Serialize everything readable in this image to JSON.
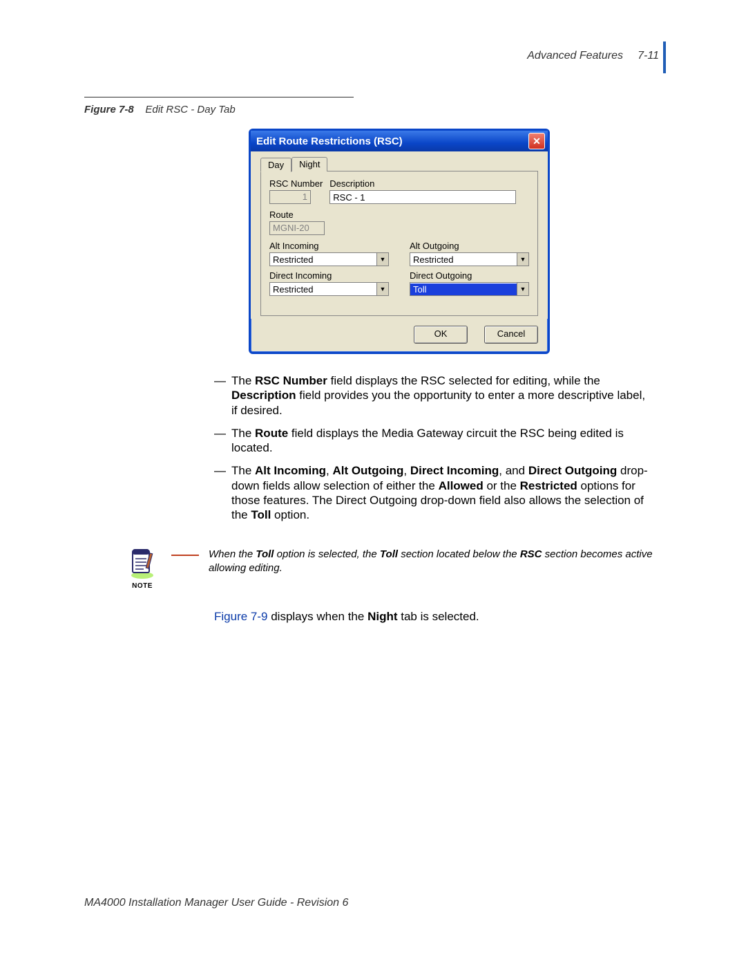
{
  "header": {
    "section": "Advanced Features",
    "pageNumber": "7-11"
  },
  "figure": {
    "label": "Figure 7-8",
    "title": "Edit RSC - Day Tab"
  },
  "dialog": {
    "title": "Edit Route Restrictions (RSC)",
    "closeGlyph": "✕",
    "tabs": {
      "day": "Day",
      "night": "Night"
    },
    "labels": {
      "rscNumber": "RSC Number",
      "description": "Description",
      "route": "Route",
      "altIncoming": "Alt Incoming",
      "altOutgoing": "Alt Outgoing",
      "directIncoming": "Direct Incoming",
      "directOutgoing": "Direct Outgoing"
    },
    "values": {
      "rscNumber": "1",
      "description": "RSC - 1",
      "route": "MGNI-20",
      "altIncoming": "Restricted",
      "altOutgoing": "Restricted",
      "directIncoming": "Restricted",
      "directOutgoing": "Toll"
    },
    "buttons": {
      "ok": "OK",
      "cancel": "Cancel"
    }
  },
  "bullets": {
    "b1_pre": "The ",
    "b1_bold1": "RSC Number",
    "b1_mid1": " field displays the RSC selected for editing, while the ",
    "b1_bold2": "Description",
    "b1_post": " field provides you the opportunity to enter a more descriptive label, if desired.",
    "b2_pre": "The ",
    "b2_bold1": "Route",
    "b2_post": " field displays the Media Gateway circuit the RSC being edited is located.",
    "b3_pre": "The ",
    "b3_bold1": "Alt Incoming",
    "b3_c1": ", ",
    "b3_bold2": "Alt Outgoing",
    "b3_c2": ", ",
    "b3_bold3": "Direct Incoming",
    "b3_c3": ", and ",
    "b3_bold4": "Direct Outgoing",
    "b3_mid": " drop-down fields allow selection of either the ",
    "b3_bold5": "Allowed",
    "b3_or": " or the ",
    "b3_bold6": "Restricted",
    "b3_post1": " options for those features. The Direct Outgoing drop-down field also allows the selection of the ",
    "b3_bold7": "Toll",
    "b3_post2": " option."
  },
  "note": {
    "label": "NOTE",
    "pre": "When the ",
    "b1": "Toll",
    "mid1": " option is selected, the ",
    "b2": "Toll",
    "mid2": " section located below the ",
    "b3": "RSC",
    "post": " section becomes active allowing editing."
  },
  "afterNote": {
    "link": "Figure 7-9",
    "mid": " displays when the ",
    "bold": "Night",
    "post": " tab is selected."
  },
  "footer": "MA4000 Installation Manager User Guide - Revision 6"
}
